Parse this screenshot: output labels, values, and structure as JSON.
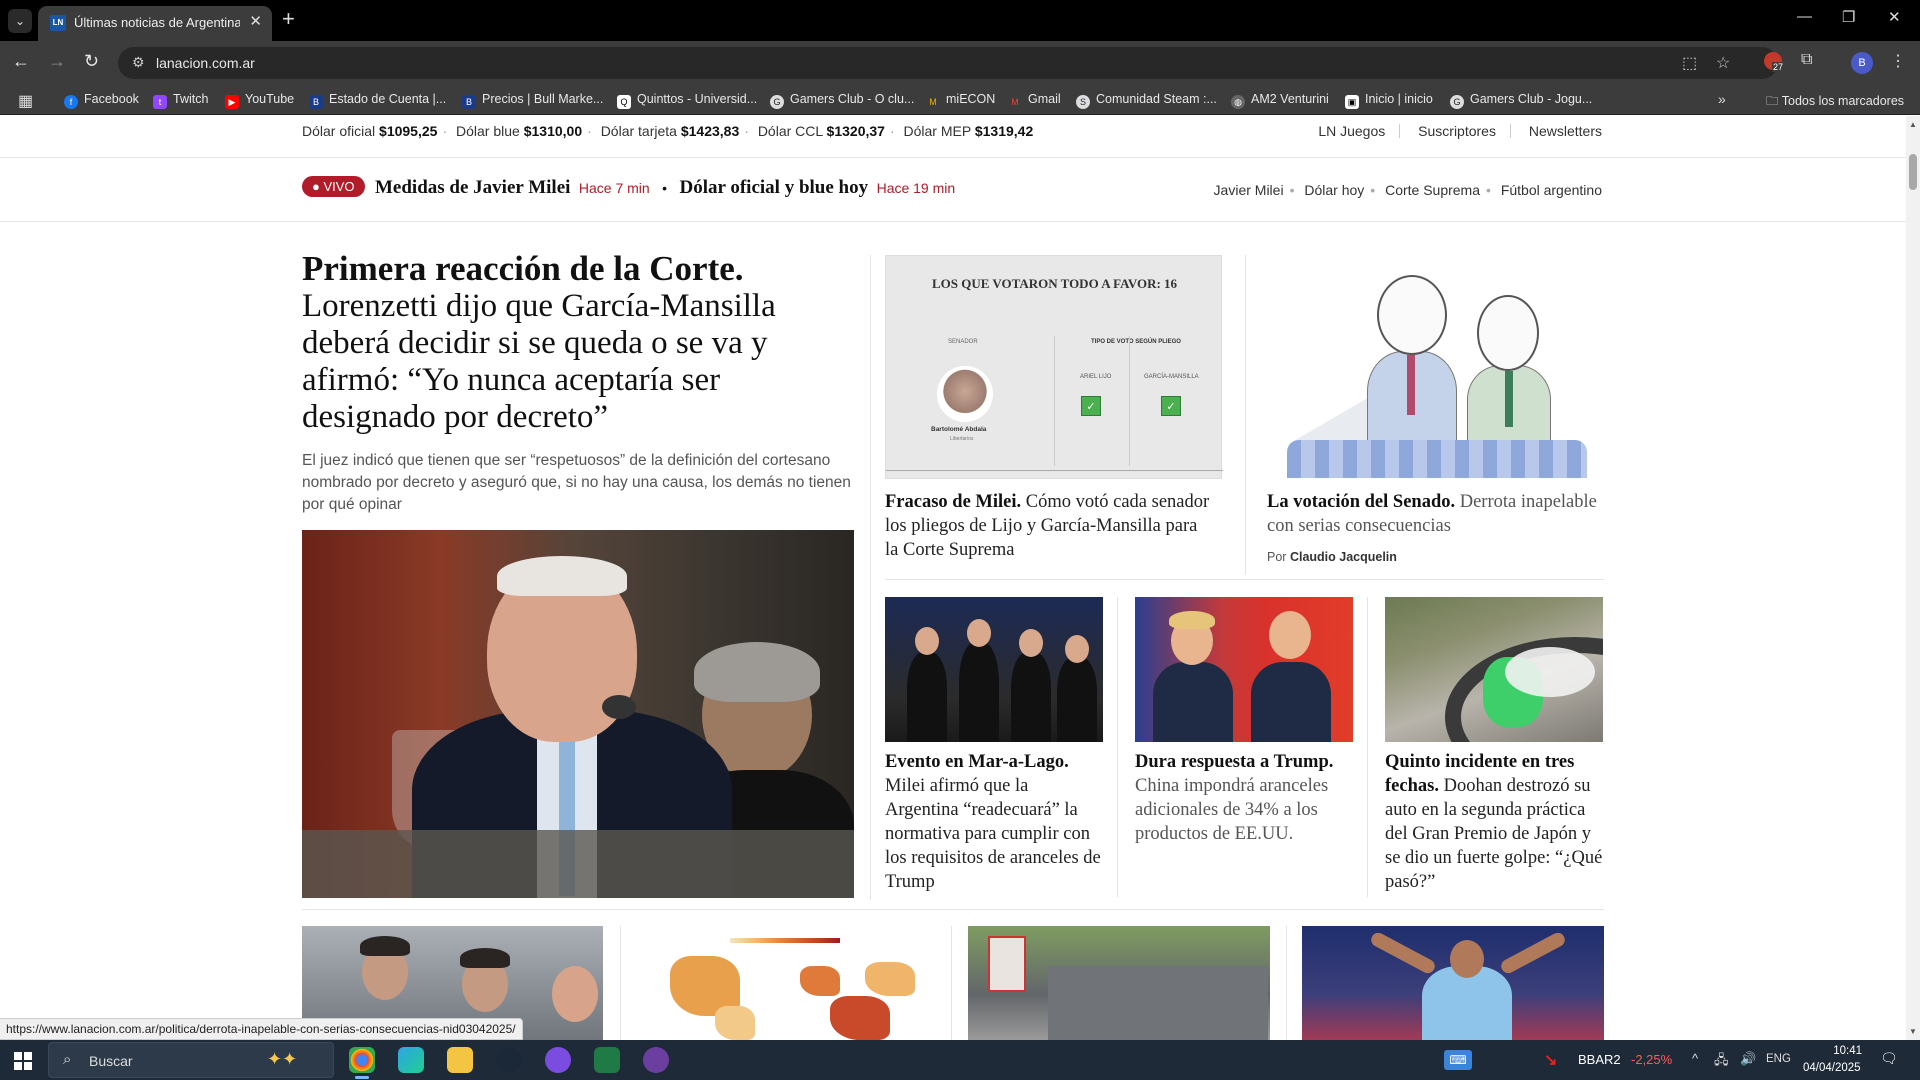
{
  "browser": {
    "tab_title": "Últimas noticias de Argentina y",
    "tab_favicon": "LN",
    "url": "lanacion.com.ar",
    "profile_initial": "B",
    "ext_badge": "27",
    "bookmarks": [
      {
        "label": "Facebook",
        "icon": "facebook-icon",
        "color": "#1877f2"
      },
      {
        "label": "Twitch",
        "icon": "twitch-icon",
        "color": "#9146ff"
      },
      {
        "label": "YouTube",
        "icon": "youtube-icon",
        "color": "#ff0000"
      },
      {
        "label": "Estado de Cuenta |...",
        "icon": "bank-icon",
        "color": "#1a3a8a"
      },
      {
        "label": "Precios | Bull Marke...",
        "icon": "bull-icon",
        "color": "#1a3a8a"
      },
      {
        "label": "Quinttos - Universid...",
        "icon": "quinttos-icon",
        "color": "#fff"
      },
      {
        "label": "Gamers Club - O clu...",
        "icon": "gamersclub-icon",
        "color": "#2a2a2a"
      },
      {
        "label": "miECON",
        "icon": "miecon-icon",
        "color": "#f0b000"
      },
      {
        "label": "Gmail",
        "icon": "gmail-icon",
        "color": "#ea4335"
      },
      {
        "label": "Comunidad Steam :...",
        "icon": "steam-icon",
        "color": "#1b2838"
      },
      {
        "label": "AM2 Venturini",
        "icon": "am2-icon",
        "color": "#555"
      },
      {
        "label": "Inicio | inicio",
        "icon": "inicio-icon",
        "color": "#fff"
      },
      {
        "label": "Gamers Club - Jogu...",
        "icon": "gamersclub-icon",
        "color": "#2a2a2a"
      }
    ],
    "all_bookmarks": "Todos los marcadores"
  },
  "dolar": [
    {
      "label": "Dólar oficial",
      "value": "$1095,25"
    },
    {
      "label": "Dólar blue",
      "value": "$1310,00"
    },
    {
      "label": "Dólar tarjeta",
      "value": "$1423,83"
    },
    {
      "label": "Dólar CCL",
      "value": "$1320,37"
    },
    {
      "label": "Dólar MEP",
      "value": "$1319,42"
    }
  ],
  "top_links": [
    "LN Juegos",
    "Suscriptores",
    "Newsletters"
  ],
  "live": {
    "badge": "VIVO",
    "items": [
      {
        "title": "Medidas de Javier Milei",
        "time": "Hace 7 min"
      },
      {
        "title": "Dólar oficial y blue hoy",
        "time": "Hace 19 min"
      }
    ]
  },
  "topics": [
    "Javier Milei",
    "Dólar hoy",
    "Corte Suprema",
    "Fútbol argentino"
  ],
  "lead": {
    "kicker": "Primera reacción de la Corte.",
    "title": "Lorenzetti dijo que García-Mansilla deberá decidir si se queda o se va y afirmó: “Yo nunca aceptaría ser designado por decreto”",
    "summary": "El juez indicó que tienen que ser “respetuosos” de la definición del cortesano nombrado por decreto y aseguró que, si no hay una causa, los demás no tienen por qué opinar"
  },
  "vote_graphic": {
    "title": "LOS QUE VOTARON TODO A FAVOR: 16",
    "col_left": "SENADOR",
    "col_right": "TIPO DE VOTO SEGÚN PLIEGO",
    "sub1": "ARIEL LIJO",
    "sub2": "GARCÍA-MANSILLA",
    "senator": "Bartolomé Abdala",
    "party": "Libertarios",
    "check": "✓"
  },
  "stories": {
    "milei_vote": {
      "kicker": "Fracaso de Milei.",
      "text": " Cómo votó cada senador los pliegos de Lijo y García-Mansilla para la Corte Suprema"
    },
    "senado": {
      "kicker": "La votación del Senado.",
      "text": " Derrota inapelable con serias consecuencias",
      "byline_prefix": "Por",
      "author": "Claudio Jacquelin"
    },
    "mar_a_lago": {
      "kicker": "Evento en Mar-a-Lago.",
      "text": " Milei afirmó que la Argentina “readecuará” la normativa para cumplir con los requisitos de aranceles de Trump"
    },
    "china": {
      "kicker": "Dura respuesta a Trump.",
      "text": " China impondrá aranceles adicionales de 34% a los productos de EE.UU."
    },
    "doohan": {
      "kicker": "Quinto incidente en tres fechas.",
      "text": " Doohan destrozó su auto en la segunda práctica del Gran Premio de Japón y se dio un fuerte golpe: “¿Qué pasó?”"
    }
  },
  "status_url": "https://www.lanacion.com.ar/politica/derrota-inapelable-con-serias-consecuencias-nid03042025/",
  "taskbar": {
    "search": "Buscar",
    "stock_symbol": "BBAR2",
    "stock_change": "-2,25%",
    "lang": "ENG",
    "time": "10:41",
    "date": "04/04/2025"
  },
  "colors": {
    "accent_red": "#b01c29",
    "chrome_dark": "#3c3c3c",
    "taskbar": "#1f2a38"
  }
}
